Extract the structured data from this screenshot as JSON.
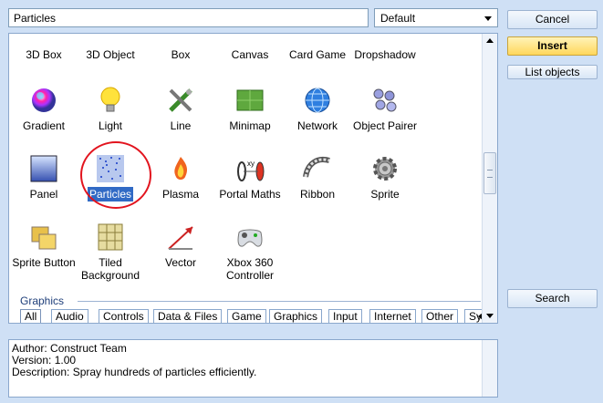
{
  "search": {
    "value": "Particles"
  },
  "filter": {
    "selected": "Default"
  },
  "buttons": {
    "cancel": "Cancel",
    "insert": "Insert",
    "list_objects": "List objects",
    "search": "Search"
  },
  "rows": [
    [
      {
        "label": "3D Box",
        "icon": "3d-box-icon"
      },
      {
        "label": "3D Object",
        "icon": "3d-object-icon"
      },
      {
        "label": "Box",
        "icon": "box-icon"
      },
      {
        "label": "Canvas",
        "icon": "canvas-icon"
      },
      {
        "label": "Card Game",
        "icon": "card-game-icon"
      },
      {
        "label": "Dropshadow",
        "icon": "dropshadow-icon"
      }
    ],
    [
      {
        "label": "Gradient",
        "icon": "gradient-icon"
      },
      {
        "label": "Light",
        "icon": "light-bulb-icon"
      },
      {
        "label": "Line",
        "icon": "line-tools-icon"
      },
      {
        "label": "Minimap",
        "icon": "minimap-icon"
      },
      {
        "label": "Network",
        "icon": "network-globe-icon"
      },
      {
        "label": "Object Pairer",
        "icon": "object-pairer-icon"
      }
    ],
    [
      {
        "label": "Panel",
        "icon": "panel-icon"
      },
      {
        "label": "Particles",
        "icon": "particles-icon",
        "selected": true
      },
      {
        "label": "Plasma",
        "icon": "plasma-flame-icon"
      },
      {
        "label": "Portal Maths",
        "icon": "portal-maths-icon"
      },
      {
        "label": "Ribbon",
        "icon": "ribbon-icon"
      },
      {
        "label": "Sprite",
        "icon": "sprite-gear-icon"
      }
    ],
    [
      {
        "label": "Sprite Button",
        "icon": "sprite-button-icon"
      },
      {
        "label": "Tiled Background",
        "icon": "tiled-background-icon"
      },
      {
        "label": "Vector",
        "icon": "vector-icon"
      },
      {
        "label": "Xbox 360 Controller",
        "icon": "xbox-controller-icon"
      }
    ]
  ],
  "group_header": "Graphics",
  "tabs": [
    "All",
    "Audio",
    "Controls",
    "Data & Files",
    "Game",
    "Graphics",
    "Input",
    "Internet",
    "Other",
    "Sy"
  ],
  "description": {
    "author": "Author: Construct Team",
    "version": "Version: 1.00",
    "text": "Description: Spray hundreds of particles efficiently."
  },
  "colors": {
    "selection": "#316ac5",
    "highlight_ring": "#e2141e",
    "insert_button": "#ffd75c"
  }
}
